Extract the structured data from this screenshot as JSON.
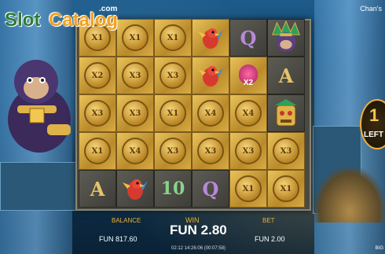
{
  "brand": {
    "slot": "Slot",
    "catalog": "Catalog",
    "com": ".com"
  },
  "game_title": "Chan's",
  "grid": [
    [
      {
        "t": "coin",
        "v": "X1"
      },
      {
        "t": "coin",
        "v": "X1"
      },
      {
        "t": "coin",
        "v": "X1"
      },
      {
        "t": "bird"
      },
      {
        "t": "letter",
        "v": "Q",
        "cls": "q",
        "bg": "stone"
      },
      {
        "t": "king",
        "bg": "stone"
      }
    ],
    [
      {
        "t": "coin",
        "v": "X2"
      },
      {
        "t": "coin",
        "v": "X3"
      },
      {
        "t": "coin",
        "v": "X3"
      },
      {
        "t": "bird"
      },
      {
        "t": "skull",
        "v": "X2"
      },
      {
        "t": "letter",
        "v": "A",
        "cls": "a",
        "bg": "stone"
      }
    ],
    [
      {
        "t": "coin",
        "v": "X3"
      },
      {
        "t": "coin",
        "v": "X3"
      },
      {
        "t": "coin",
        "v": "X1"
      },
      {
        "t": "coin",
        "v": "X4"
      },
      {
        "t": "coin",
        "v": "X4"
      },
      {
        "t": "mask",
        "bg": "stone"
      }
    ],
    [
      {
        "t": "coin",
        "v": "X1"
      },
      {
        "t": "coin",
        "v": "X4"
      },
      {
        "t": "coin",
        "v": "X3"
      },
      {
        "t": "coin",
        "v": "X3"
      },
      {
        "t": "coin",
        "v": "X3"
      },
      {
        "t": "coin",
        "v": "X3"
      }
    ],
    [
      {
        "t": "letter",
        "v": "A",
        "cls": "a",
        "bg": "stone"
      },
      {
        "t": "bird",
        "bg": "stone"
      },
      {
        "t": "letter",
        "v": "10",
        "cls": "ten",
        "bg": "stone"
      },
      {
        "t": "letter",
        "v": "Q",
        "cls": "q",
        "bg": "stone"
      },
      {
        "t": "coin",
        "v": "X1"
      },
      {
        "t": "coin",
        "v": "X1"
      }
    ]
  ],
  "left_badge": {
    "digit": "1",
    "text": "LEFT"
  },
  "hud": {
    "balance_label": "BALANCE",
    "balance_value": "FUN 817.60",
    "win_label": "WIN",
    "win_value": "FUN 2.80",
    "bet_label": "BET",
    "bet_value": "FUN 2.00",
    "time": "02:12 14:26:06 (00:07:58)",
    "bottom_right": "BIG"
  },
  "colors": {
    "gold_cell": "#e9c25a",
    "stone_cell": "#5d5c54",
    "accent_label": "#f0b030"
  }
}
